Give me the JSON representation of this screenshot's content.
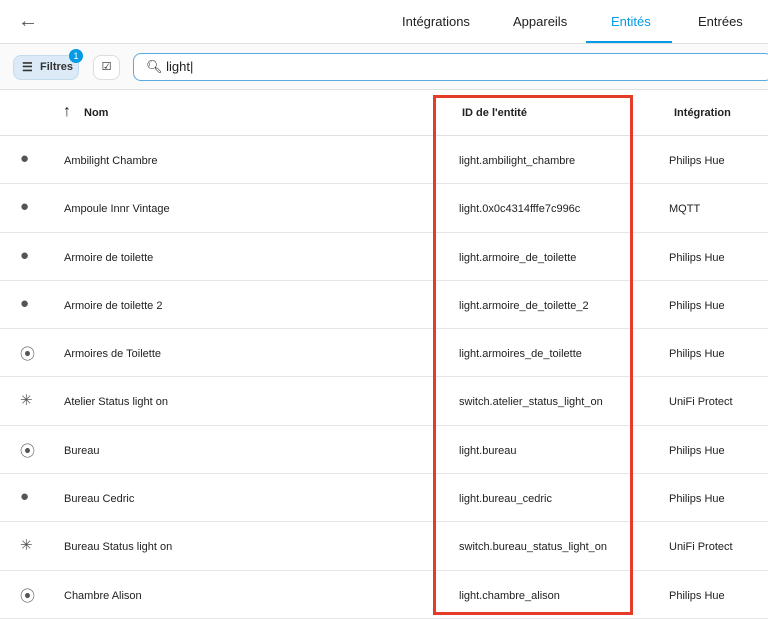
{
  "tabs": [
    "Intégrations",
    "Appareils",
    "Entités",
    "Entrées"
  ],
  "toolbar": {
    "filters_label": "Filtres",
    "filters_count": "1",
    "search_value": "light"
  },
  "columns": {
    "name": "Nom",
    "entity_id": "ID de l'entité",
    "integration": "Intégration"
  },
  "rows": [
    {
      "icon": "lightbulb-icon",
      "name": "Ambilight Chambre",
      "id": "light.ambilight_chambre",
      "integration": "Philips Hue"
    },
    {
      "icon": "lightbulb-icon",
      "name": "Ampoule Innr Vintage",
      "id": "light.0x0c4314fffe7c996c",
      "integration": "MQTT"
    },
    {
      "icon": "lightbulb-icon",
      "name": "Armoire de toilette",
      "id": "light.armoire_de_toilette",
      "integration": "Philips Hue"
    },
    {
      "icon": "lightbulb-icon",
      "name": "Armoire de toilette 2",
      "id": "light.armoire_de_toilette_2",
      "integration": "Philips Hue"
    },
    {
      "icon": "lightbulb-group-icon",
      "name": "Armoires de Toilette",
      "id": "light.armoires_de_toilette",
      "integration": "Philips Hue"
    },
    {
      "icon": "led-on-icon",
      "name": "Atelier Status light on",
      "id": "switch.atelier_status_light_on",
      "integration": "UniFi Protect"
    },
    {
      "icon": "lightbulb-group-icon",
      "name": "Bureau",
      "id": "light.bureau",
      "integration": "Philips Hue"
    },
    {
      "icon": "lightbulb-icon",
      "name": "Bureau Cedric",
      "id": "light.bureau_cedric",
      "integration": "Philips Hue"
    },
    {
      "icon": "led-on-icon",
      "name": "Bureau Status light on",
      "id": "switch.bureau_status_light_on",
      "integration": "UniFi Protect"
    },
    {
      "icon": "lightbulb-group-icon",
      "name": "Chambre Alison",
      "id": "light.chambre_alison",
      "integration": "Philips Hue"
    }
  ]
}
